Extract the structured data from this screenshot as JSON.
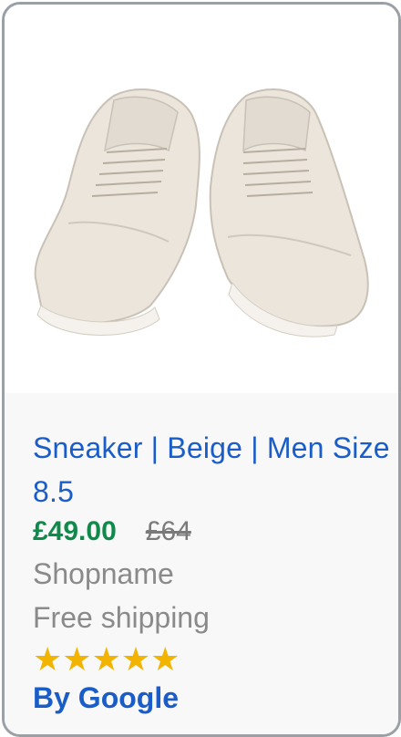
{
  "product": {
    "image_alt": "Beige sneakers",
    "title": "Sneaker  | Beige | Men Size 8.5",
    "price": "£49.00",
    "old_price": "£64",
    "shop": "Shopname",
    "shipping": "Free shipping",
    "rating_stars": 5,
    "byline": "By Google"
  },
  "colors": {
    "title": "#1a5cc8",
    "price": "#0f8a4a",
    "muted": "#8a8a8a",
    "star": "#f3b400",
    "shoe": "#ebe5dc"
  },
  "icons": {
    "star": "star-icon"
  }
}
